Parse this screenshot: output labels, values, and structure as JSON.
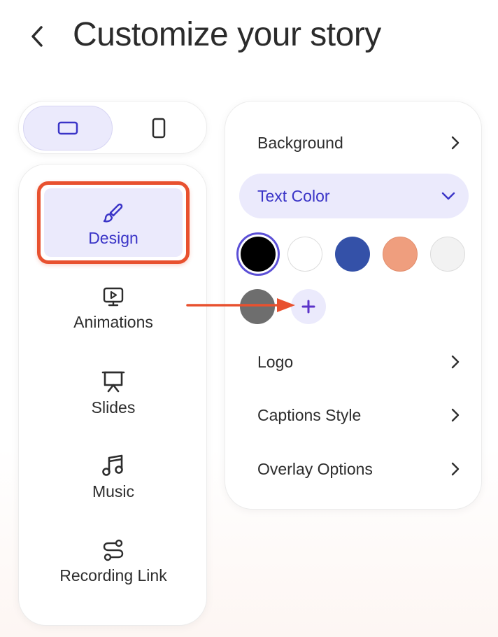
{
  "header": {
    "title": "Customize your story",
    "back_icon": "chevron-left-icon"
  },
  "orientation_toggle": {
    "options": [
      {
        "name": "landscape",
        "icon": "landscape-icon",
        "selected": true
      },
      {
        "name": "portrait",
        "icon": "portrait-icon",
        "selected": false
      }
    ]
  },
  "nav": {
    "items": [
      {
        "label": "Design",
        "icon": "paintbrush-icon",
        "active": true
      },
      {
        "label": "Animations",
        "icon": "play-screen-icon",
        "active": false
      },
      {
        "label": "Slides",
        "icon": "presentation-icon",
        "active": false
      },
      {
        "label": "Music",
        "icon": "music-note-icon",
        "active": false
      },
      {
        "label": "Recording Link",
        "icon": "route-icon",
        "active": false
      }
    ]
  },
  "panel": {
    "background_label": "Background",
    "text_color_label": "Text Color",
    "logo_label": "Logo",
    "captions_label": "Captions Style",
    "overlay_label": "Overlay Options",
    "swatches": [
      "#000000",
      "#ffffff",
      "#3451a8",
      "#ef9e7e",
      "#f2f2f2",
      "#6e6e6e"
    ],
    "selected_swatch": "#000000",
    "add_icon": "plus-icon"
  },
  "colors": {
    "accent": "#3a34c7",
    "highlight_bg": "#ebeafc",
    "annotation": "#e8512f"
  }
}
